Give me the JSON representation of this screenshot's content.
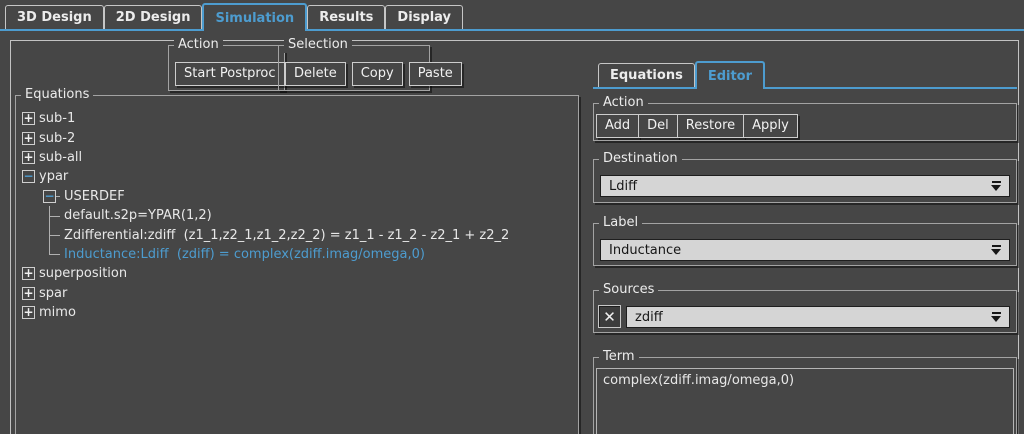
{
  "colors": {
    "background": "#464646",
    "accent_blue": "#4d9ccf",
    "combo_bg": "#d5d5d5"
  },
  "top_tabs": {
    "items": [
      {
        "label": "3D Design",
        "active": false
      },
      {
        "label": "2D Design",
        "active": false
      },
      {
        "label": "Simulation",
        "active": true
      },
      {
        "label": "Results",
        "active": false
      },
      {
        "label": "Display",
        "active": false
      }
    ]
  },
  "toolbar": {
    "action_group": {
      "label": "Action",
      "buttons": [
        "Start Postproc"
      ]
    },
    "selection_group": {
      "label": "Selection",
      "buttons": [
        "Delete",
        "Copy",
        "Paste"
      ]
    }
  },
  "equations_panel": {
    "label": "Equations",
    "tree": [
      {
        "level": 0,
        "expander": "plus",
        "branch": null,
        "label": "sub-1",
        "highlight": false
      },
      {
        "level": 0,
        "expander": "plus",
        "branch": null,
        "label": "sub-2",
        "highlight": false
      },
      {
        "level": 0,
        "expander": "plus",
        "branch": null,
        "label": "sub-all",
        "highlight": false
      },
      {
        "level": 0,
        "expander": "minus",
        "branch": null,
        "label": "ypar",
        "highlight": false
      },
      {
        "level": 1,
        "expander": "minus",
        "branch": null,
        "label": "USERDEF",
        "highlight": false
      },
      {
        "level": 2,
        "expander": null,
        "branch": "mid",
        "label": "default.s2p=YPAR(1,2)",
        "highlight": false
      },
      {
        "level": 2,
        "expander": null,
        "branch": "mid",
        "label": "Zdifferential:zdiff  (z1_1,z2_1,z1_2,z2_2) = z1_1 - z1_2 - z2_1 + z2_2",
        "highlight": false
      },
      {
        "level": 2,
        "expander": null,
        "branch": "last",
        "label": "Inductance:Ldiff  (zdiff) = complex(zdiff.imag/omega,0)",
        "highlight": true
      },
      {
        "level": 0,
        "expander": "plus",
        "branch": null,
        "label": "superposition",
        "highlight": false
      },
      {
        "level": 0,
        "expander": "plus",
        "branch": null,
        "label": "spar",
        "highlight": false
      },
      {
        "level": 0,
        "expander": "plus",
        "branch": null,
        "label": "mimo",
        "highlight": false
      }
    ]
  },
  "right_panel": {
    "tabs": [
      {
        "label": "Equations",
        "active": false
      },
      {
        "label": "Editor",
        "active": true
      }
    ],
    "action_group": {
      "label": "Action",
      "buttons": [
        "Add",
        "Del",
        "Restore",
        "Apply"
      ]
    },
    "destination_group": {
      "label": "Destination",
      "value": "Ldiff"
    },
    "label_group": {
      "label": "Label",
      "value": "Inductance"
    },
    "sources_group": {
      "label": "Sources",
      "checkbox_checked": true,
      "checkbox_glyph": "✕",
      "value": "zdiff"
    },
    "term_group": {
      "label": "Term",
      "value": "complex(zdiff.imag/omega,0)"
    }
  }
}
